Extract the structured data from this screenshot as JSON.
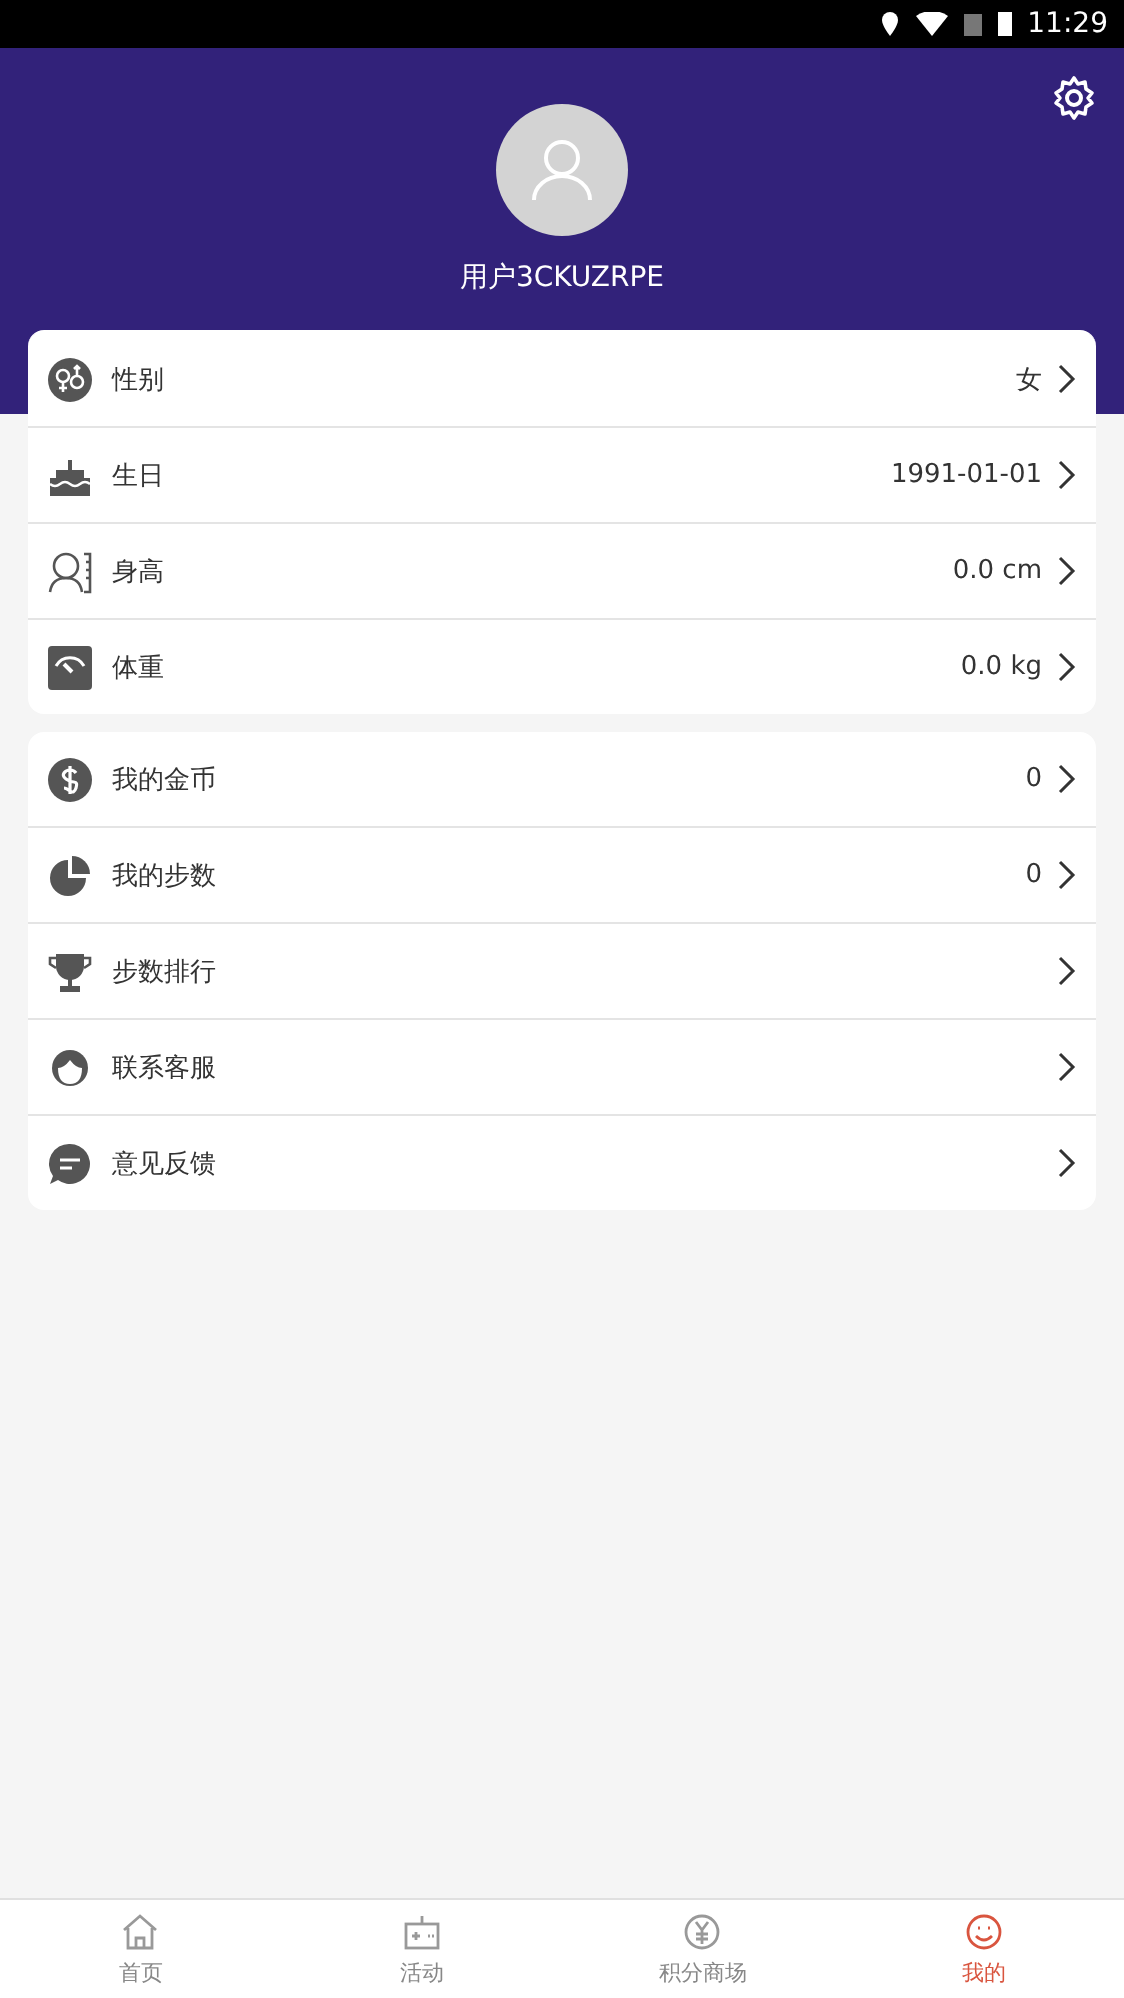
{
  "status_bar": {
    "time": "11:29"
  },
  "profile": {
    "username": "用户3CKUZRPE"
  },
  "sections": [
    {
      "rows": [
        {
          "label": "性别",
          "value": "女"
        },
        {
          "label": "生日",
          "value": "1991-01-01"
        },
        {
          "label": "身高",
          "value": "0.0 cm"
        },
        {
          "label": "体重",
          "value": "0.0 kg"
        }
      ]
    },
    {
      "rows": [
        {
          "label": "我的金币",
          "value": "0"
        },
        {
          "label": "我的步数",
          "value": "0"
        },
        {
          "label": "步数排行"
        },
        {
          "label": "联系客服"
        },
        {
          "label": "意见反馈"
        }
      ]
    }
  ],
  "bottom_nav": [
    {
      "label": "首页",
      "selected": false
    },
    {
      "label": "活动",
      "selected": false
    },
    {
      "label": "积分商场",
      "selected": false
    },
    {
      "label": "我的",
      "selected": true
    }
  ]
}
